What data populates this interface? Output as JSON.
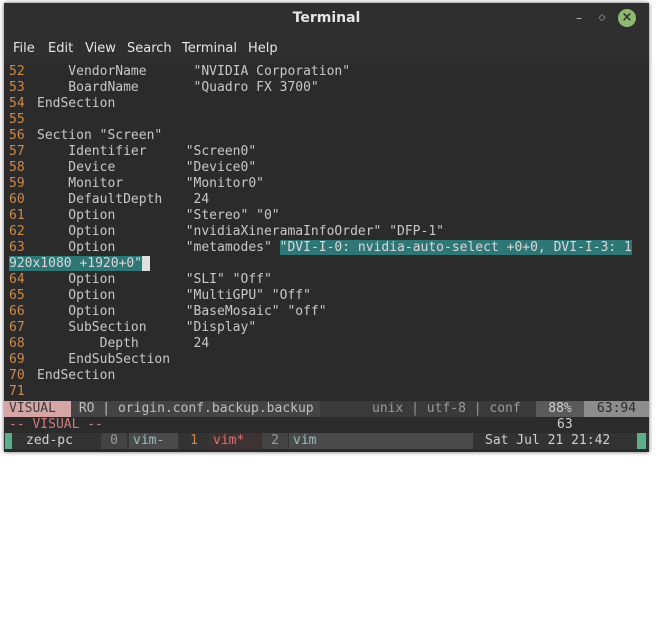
{
  "window": {
    "title": "Terminal"
  },
  "menu": [
    "File",
    "Edit",
    "View",
    "Search",
    "Terminal",
    "Help"
  ],
  "lines": [
    {
      "n": "52",
      "text": "    VendorName      \"NVIDIA Corporation\""
    },
    {
      "n": "53",
      "text": "    BoardName       \"Quadro FX 3700\""
    },
    {
      "n": "54",
      "text": "EndSection"
    },
    {
      "n": "55",
      "text": ""
    },
    {
      "n": "56",
      "text": "Section \"Screen\""
    },
    {
      "n": "57",
      "text": "    Identifier     \"Screen0\""
    },
    {
      "n": "58",
      "text": "    Device         \"Device0\""
    },
    {
      "n": "59",
      "text": "    Monitor        \"Monitor0\""
    },
    {
      "n": "60",
      "text": "    DefaultDepth    24"
    },
    {
      "n": "61",
      "text": "    Option         \"Stereo\" \"0\""
    },
    {
      "n": "62",
      "text": "    Option         \"nvidiaXineramaInfoOrder\" \"DFP-1\""
    },
    {
      "n": "63",
      "text": "    Option         \"metamodes\" "
    },
    {
      "n": "64",
      "text": "    Option         \"SLI\" \"Off\""
    },
    {
      "n": "65",
      "text": "    Option         \"MultiGPU\" \"Off\""
    },
    {
      "n": "66",
      "text": "    Option         \"BaseMosaic\" \"off\""
    },
    {
      "n": "67",
      "text": "    SubSection     \"Display\""
    },
    {
      "n": "68",
      "text": "        Depth       24"
    },
    {
      "n": "69",
      "text": "    EndSubSection"
    },
    {
      "n": "70",
      "text": "EndSection"
    },
    {
      "n": "71",
      "text": ""
    }
  ],
  "highlight": {
    "part1": "\"DVI-I-0: nvidia-auto-select +0+0, DVI-I-3: 1",
    "part2": "920x1080 +1920+0\""
  },
  "status": {
    "mode": "VISUAL",
    "file": " RO | origin.conf.backup.backup",
    "info": "unix | utf-8 | conf",
    "percent": "88%",
    "pos": "63:94"
  },
  "cmdline": {
    "mode": "-- VISUAL --",
    "count": "63"
  },
  "tmux": {
    "session": "zed-pc",
    "w0": "0",
    "w0name": "vim-",
    "w1": "1",
    "w1name": "vim*",
    "w2": "2",
    "w2name": "vim",
    "clock": "Sat Jul 21 21:42"
  },
  "colors": {
    "accent_teal": "#2f7676",
    "line_number": "#d2893f",
    "close_btn": "#8fb870"
  }
}
